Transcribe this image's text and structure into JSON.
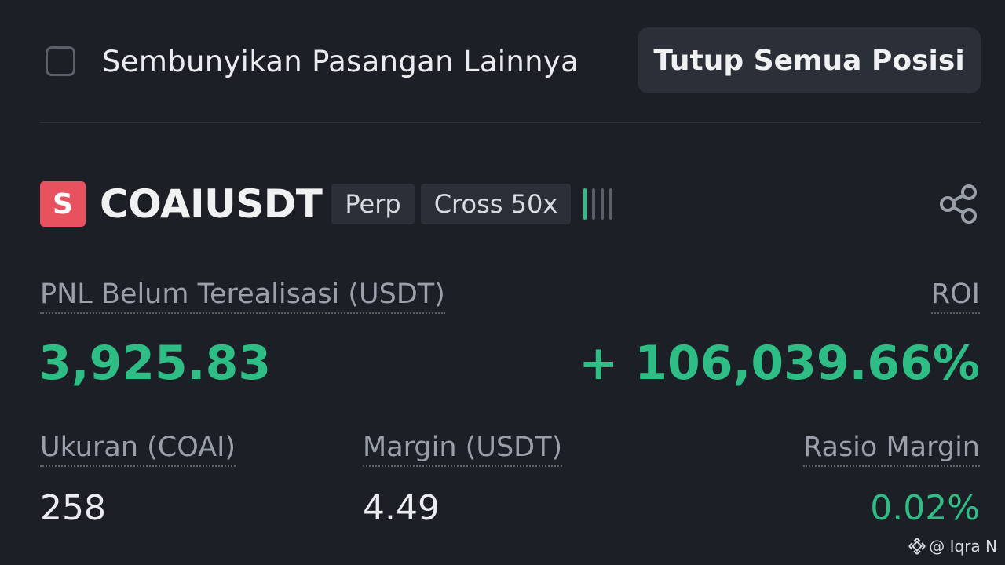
{
  "header": {
    "hide_label": "Sembunyikan Pasangan Lainnya",
    "hide_checked": false,
    "close_all_label": "Tutup Semua Posisi"
  },
  "position": {
    "coin_letter": "S",
    "symbol": "COAIUSDT",
    "tags": [
      "Perp",
      "Cross 50x"
    ],
    "pnl_label": "PNL Belum Terealisasi (USDT)",
    "pnl_value": "3,925.83",
    "roi_label": "ROI",
    "roi_value": "+ 106,039.66%",
    "size_label": "Ukuran (COAI)",
    "size_value": "258",
    "margin_label": "Margin (USDT)",
    "margin_value": "4.49",
    "margin_ratio_label": "Rasio Margin",
    "margin_ratio_value": "0.02%"
  },
  "watermark": {
    "text": "@ Iqra N"
  },
  "colors": {
    "background": "#1c1f26",
    "positive": "#2ebd85",
    "coin_icon": "#e8525f"
  },
  "icons": {
    "share": "share-icon",
    "brand": "binance-logo-icon"
  }
}
